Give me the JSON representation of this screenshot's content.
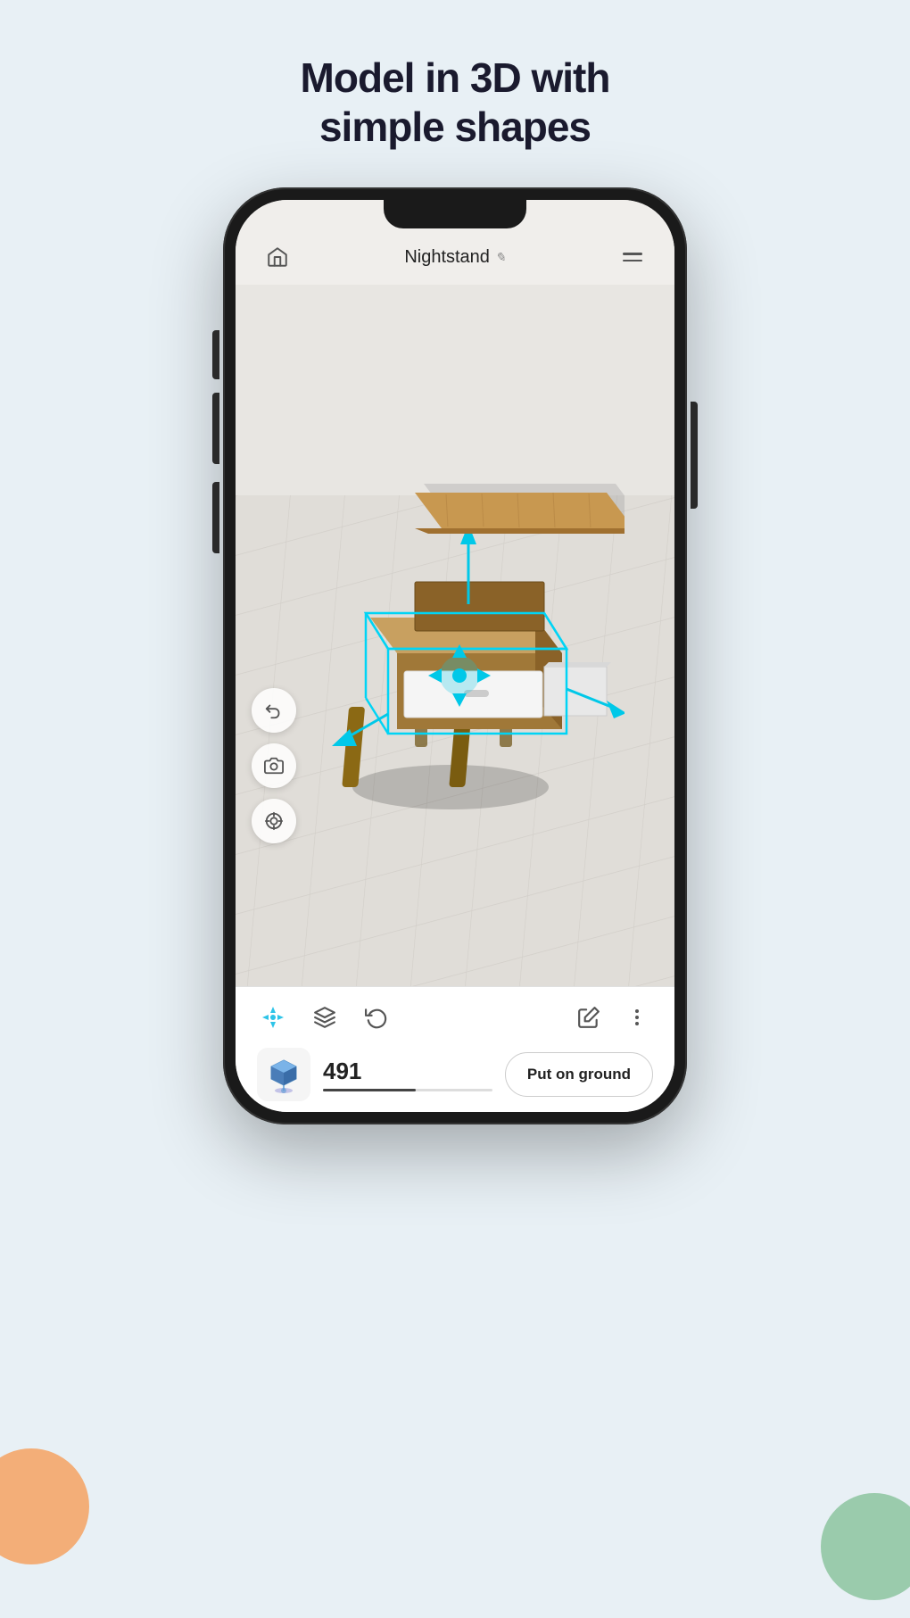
{
  "page": {
    "title_line1": "Model in 3D with",
    "title_line2": "simple shapes",
    "background_color": "#e8f0f5"
  },
  "phone": {
    "app_title": "Nightstand",
    "edit_icon_label": "✎",
    "value": "491",
    "put_on_ground_label": "Put on ground"
  },
  "toolbar": {
    "undo_label": "undo",
    "layers_label": "layers",
    "rotate_label": "rotate",
    "paint_label": "paint",
    "more_label": "more"
  },
  "icons": {
    "home": "⌂",
    "undo_left": "↩",
    "camera": "⊙",
    "target": "◎",
    "move": "✦",
    "layers": "❑",
    "undo": "↺",
    "paint": "▼",
    "more": "⋮"
  }
}
